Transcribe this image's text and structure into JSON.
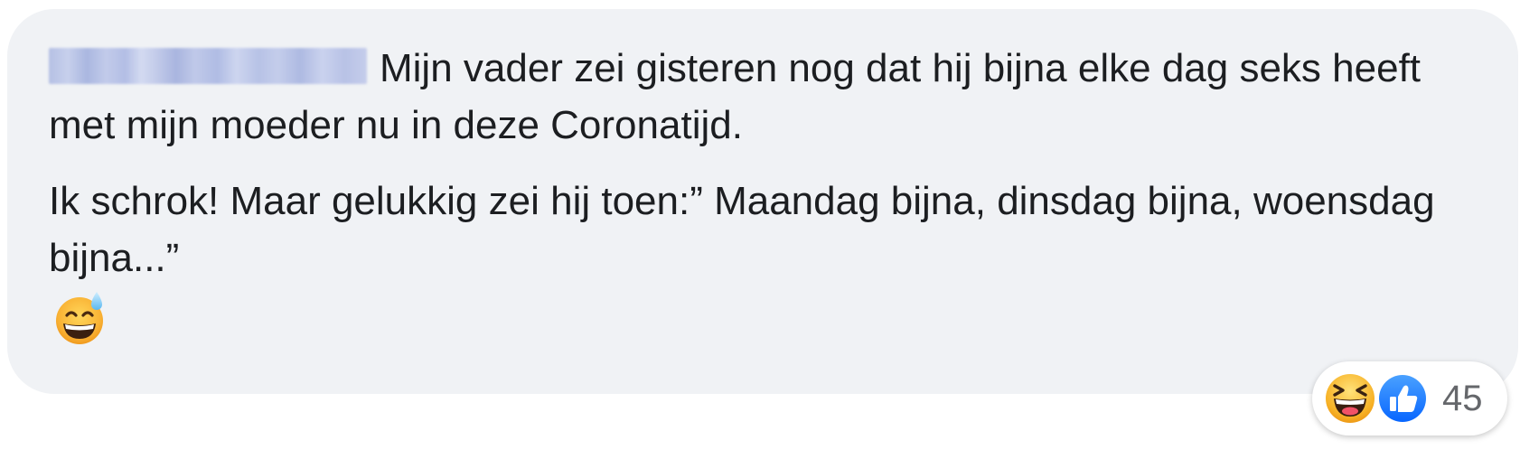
{
  "comment": {
    "author_name": "",
    "author_name_obscured": true,
    "paragraphs": [
      "Mijn vader zei gisteren nog dat hij bijna elke dag seks heeft met mijn moeder nu in deze Coronatijd.",
      "Ik schrok! Maar gelukkig zei hij toen:” Maandag bijna, dinsdag bijna, woensdag bijna...”"
    ],
    "trailing_emoji": "grinning-face-with-sweat",
    "bubble_color": "#f0f2f5",
    "text_color": "#1c1e21"
  },
  "reactions": {
    "icons": [
      "haha-reaction",
      "like-reaction"
    ],
    "count": "45",
    "count_color": "#65676b",
    "like_color": "#1877f2"
  }
}
